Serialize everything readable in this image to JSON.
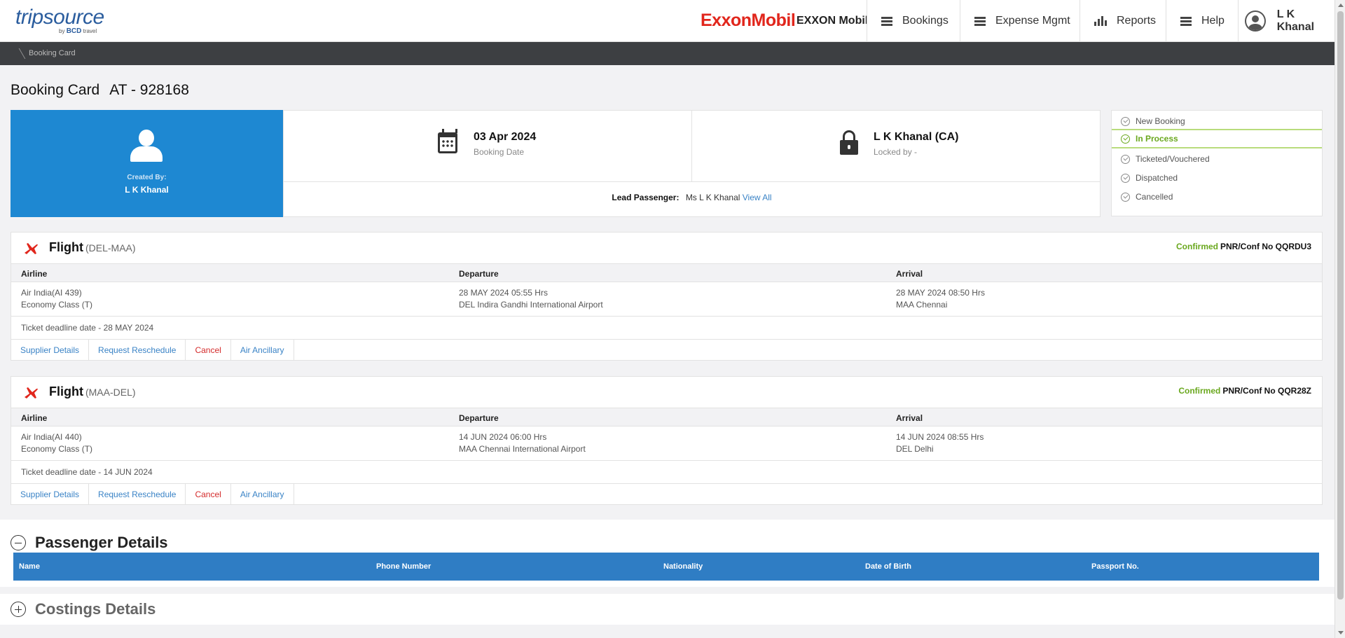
{
  "header": {
    "logo_main": "tripsource",
    "logo_sub_by": "by",
    "logo_sub_brand": "BCD",
    "logo_sub_travel": "travel",
    "brand_logo": "ExxonMobil",
    "company_name": "EXXON Mobil",
    "nav": [
      {
        "label": "Bookings",
        "icon": "menu-icon"
      },
      {
        "label": "Expense Mgmt",
        "icon": "menu-icon"
      },
      {
        "label": "Reports",
        "icon": "bar-chart-icon"
      },
      {
        "label": "Help",
        "icon": "menu-icon"
      }
    ],
    "user_name": "L K Khanal"
  },
  "breadcrumb": {
    "current": "Booking Card"
  },
  "page": {
    "title": "Booking Card",
    "booking_id": "AT - 928168"
  },
  "booking": {
    "created_by_label": "Created By:",
    "created_by_name": "L K Khanal",
    "booking_date": "03 Apr 2024",
    "booking_date_label": "Booking Date",
    "locked_name": "L K Khanal (CA)",
    "locked_label": "Locked by -",
    "lead_passenger_label": "Lead Passenger:",
    "lead_passenger_name": "Ms L K Khanal",
    "view_all": "View All"
  },
  "status": {
    "steps": [
      "New Booking",
      "In Process",
      "Ticketed/Vouchered",
      "Dispatched",
      "Cancelled"
    ],
    "active": "In Process",
    "active_color": "#6aa81e"
  },
  "flights": [
    {
      "title": "Flight",
      "route": "(DEL-MAA)",
      "status": "Confirmed",
      "pnr": "PNR/Conf No QQRDU3",
      "headers": [
        "Airline",
        "Departure",
        "Arrival"
      ],
      "airline": "Air India(AI 439)",
      "cabin": "Economy Class (T)",
      "dep_time": "28 MAY 2024 05:55 Hrs",
      "dep_place": "DEL Indira Gandhi International Airport",
      "arr_time": "28 MAY 2024 08:50 Hrs",
      "arr_place": "MAA Chennai",
      "deadline": "Ticket deadline date - 28 MAY 2024",
      "actions": [
        "Supplier Details",
        "Request Reschedule",
        "Cancel",
        "Air Ancillary"
      ]
    },
    {
      "title": "Flight",
      "route": "(MAA-DEL)",
      "status": "Confirmed",
      "pnr": "PNR/Conf No QQR28Z",
      "headers": [
        "Airline",
        "Departure",
        "Arrival"
      ],
      "airline": "Air India(AI 440)",
      "cabin": "Economy Class (T)",
      "dep_time": "14 JUN 2024 06:00 Hrs",
      "dep_place": "MAA Chennai International Airport",
      "arr_time": "14 JUN 2024 08:55 Hrs",
      "arr_place": "DEL Delhi",
      "deadline": "Ticket deadline date - 14 JUN 2024",
      "actions": [
        "Supplier Details",
        "Request Reschedule",
        "Cancel",
        "Air Ancillary"
      ]
    }
  ],
  "passenger_details": {
    "title": "Passenger Details",
    "columns": [
      "Name",
      "Phone Number",
      "Nationality",
      "Date of Birth",
      "Passport No."
    ]
  },
  "costings": {
    "title": "Costings Details"
  },
  "colors": {
    "primary_blue": "#1e88d2",
    "grid_blue": "#2f7dc4",
    "brand_red": "#e1261c",
    "cancel_red": "#d42b2b",
    "link_blue": "#3a83c6"
  }
}
